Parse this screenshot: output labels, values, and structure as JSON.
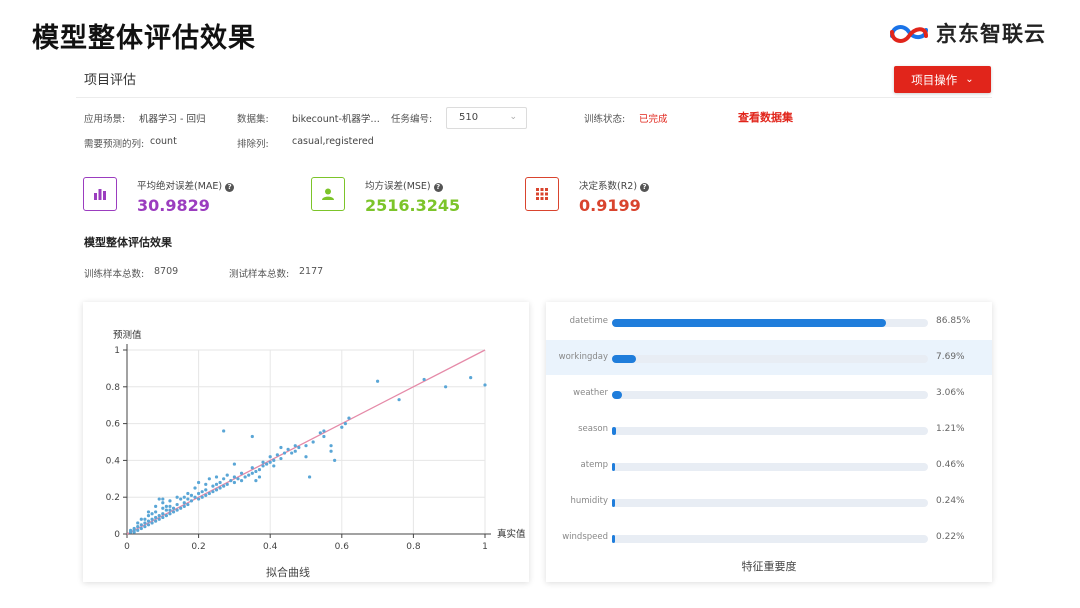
{
  "slide_title": "模型整体评估效果",
  "brand": {
    "name": "京东智联云"
  },
  "panel": {
    "title": "项目评估",
    "op_button": "项目操作",
    "view_data": "查看数据集"
  },
  "info": {
    "scene_label": "应用场景:",
    "scene_value": "机器学习 - 回归",
    "dataset_label": "数据集:",
    "dataset_value": "bikecount-机器学…",
    "task_label": "任务编号:",
    "task_value": "510",
    "status_label": "训练状态:",
    "status_value": "已完成",
    "predict_col_label": "需要预测的列:",
    "predict_col_value": "count",
    "exclude_label": "排除列:",
    "exclude_value": "casual,registered"
  },
  "metrics": [
    {
      "label": "平均绝对误差(MAE)",
      "value": "30.9829",
      "color": "#9b3dbf",
      "icon": "bar-chart-icon"
    },
    {
      "label": "均方误差(MSE)",
      "value": "2516.3245",
      "color": "#7cc42a",
      "icon": "person-icon"
    },
    {
      "label": "决定系数(R2)",
      "value": "0.9199",
      "color": "#d9442e",
      "icon": "grid-icon"
    }
  ],
  "section_title": "模型整体评估效果",
  "samples": {
    "train_label": "训练样本总数:",
    "train_value": "8709",
    "test_label": "测试样本总数:",
    "test_value": "2177"
  },
  "chart_data": [
    {
      "type": "scatter",
      "title": "拟合曲线",
      "xlabel": "真实值",
      "ylabel": "预测值",
      "xlim": [
        0,
        1
      ],
      "ylim": [
        0,
        1
      ],
      "xticks": [
        "0",
        "0.2",
        "0.4",
        "0.6",
        "0.8",
        "1"
      ],
      "yticks": [
        "0",
        "0.2",
        "0.4",
        "0.6",
        "0.8",
        "1"
      ],
      "grid": true,
      "fit_line": {
        "x": [
          0,
          1
        ],
        "y": [
          0,
          1
        ],
        "color": "#e58aa8"
      },
      "point_color": "#5aa6d6",
      "points": [
        [
          0.01,
          0.01
        ],
        [
          0.01,
          0.02
        ],
        [
          0.02,
          0.01
        ],
        [
          0.02,
          0.03
        ],
        [
          0.03,
          0.02
        ],
        [
          0.03,
          0.04
        ],
        [
          0.02,
          0.02
        ],
        [
          0.04,
          0.03
        ],
        [
          0.04,
          0.05
        ],
        [
          0.05,
          0.04
        ],
        [
          0.05,
          0.06
        ],
        [
          0.06,
          0.05
        ],
        [
          0.06,
          0.07
        ],
        [
          0.07,
          0.06
        ],
        [
          0.07,
          0.08
        ],
        [
          0.08,
          0.07
        ],
        [
          0.03,
          0.06
        ],
        [
          0.05,
          0.08
        ],
        [
          0.06,
          0.1
        ],
        [
          0.08,
          0.09
        ],
        [
          0.09,
          0.08
        ],
        [
          0.09,
          0.1
        ],
        [
          0.1,
          0.09
        ],
        [
          0.1,
          0.11
        ],
        [
          0.11,
          0.1
        ],
        [
          0.07,
          0.11
        ],
        [
          0.08,
          0.12
        ],
        [
          0.11,
          0.13
        ],
        [
          0.12,
          0.11
        ],
        [
          0.12,
          0.13
        ],
        [
          0.13,
          0.12
        ],
        [
          0.13,
          0.14
        ],
        [
          0.14,
          0.13
        ],
        [
          0.15,
          0.14
        ],
        [
          0.1,
          0.14
        ],
        [
          0.12,
          0.15
        ],
        [
          0.14,
          0.16
        ],
        [
          0.16,
          0.15
        ],
        [
          0.16,
          0.17
        ],
        [
          0.17,
          0.16
        ],
        [
          0.08,
          0.15
        ],
        [
          0.09,
          0.19
        ],
        [
          0.1,
          0.17
        ],
        [
          0.1,
          0.19
        ],
        [
          0.11,
          0.15
        ],
        [
          0.12,
          0.18
        ],
        [
          0.15,
          0.19
        ],
        [
          0.16,
          0.2
        ],
        [
          0.17,
          0.19
        ],
        [
          0.18,
          0.18
        ],
        [
          0.18,
          0.21
        ],
        [
          0.19,
          0.2
        ],
        [
          0.2,
          0.19
        ],
        [
          0.2,
          0.22
        ],
        [
          0.21,
          0.2
        ],
        [
          0.21,
          0.23
        ],
        [
          0.22,
          0.21
        ],
        [
          0.22,
          0.24
        ],
        [
          0.23,
          0.22
        ],
        [
          0.24,
          0.23
        ],
        [
          0.19,
          0.25
        ],
        [
          0.2,
          0.28
        ],
        [
          0.22,
          0.27
        ],
        [
          0.24,
          0.26
        ],
        [
          0.25,
          0.24
        ],
        [
          0.25,
          0.27
        ],
        [
          0.26,
          0.25
        ],
        [
          0.26,
          0.28
        ],
        [
          0.27,
          0.26
        ],
        [
          0.27,
          0.3
        ],
        [
          0.28,
          0.27
        ],
        [
          0.29,
          0.29
        ],
        [
          0.3,
          0.28
        ],
        [
          0.3,
          0.31
        ],
        [
          0.23,
          0.3
        ],
        [
          0.25,
          0.31
        ],
        [
          0.28,
          0.32
        ],
        [
          0.31,
          0.3
        ],
        [
          0.32,
          0.29
        ],
        [
          0.32,
          0.33
        ],
        [
          0.33,
          0.31
        ],
        [
          0.34,
          0.32
        ],
        [
          0.35,
          0.33
        ],
        [
          0.35,
          0.36
        ],
        [
          0.36,
          0.34
        ],
        [
          0.37,
          0.35
        ],
        [
          0.38,
          0.37
        ],
        [
          0.36,
          0.29
        ],
        [
          0.37,
          0.31
        ],
        [
          0.38,
          0.39
        ],
        [
          0.39,
          0.38
        ],
        [
          0.4,
          0.39
        ],
        [
          0.4,
          0.42
        ],
        [
          0.41,
          0.4
        ],
        [
          0.42,
          0.43
        ],
        [
          0.43,
          0.41
        ],
        [
          0.44,
          0.44
        ],
        [
          0.45,
          0.46
        ],
        [
          0.46,
          0.44
        ],
        [
          0.47,
          0.45
        ],
        [
          0.48,
          0.47
        ],
        [
          0.5,
          0.48
        ],
        [
          0.52,
          0.5
        ],
        [
          0.54,
          0.55
        ],
        [
          0.55,
          0.53
        ],
        [
          0.57,
          0.48
        ],
        [
          0.6,
          0.58
        ],
        [
          0.61,
          0.6
        ],
        [
          0.62,
          0.63
        ],
        [
          0.7,
          0.83
        ],
        [
          0.76,
          0.73
        ],
        [
          0.83,
          0.84
        ],
        [
          0.89,
          0.8
        ],
        [
          0.96,
          0.85
        ],
        [
          1.0,
          0.81
        ],
        [
          0.27,
          0.56
        ],
        [
          0.3,
          0.38
        ],
        [
          0.35,
          0.53
        ],
        [
          0.41,
          0.37
        ],
        [
          0.43,
          0.47
        ],
        [
          0.47,
          0.48
        ],
        [
          0.5,
          0.42
        ],
        [
          0.51,
          0.31
        ],
        [
          0.55,
          0.56
        ],
        [
          0.57,
          0.45
        ],
        [
          0.58,
          0.4
        ],
        [
          0.17,
          0.22
        ],
        [
          0.14,
          0.2
        ],
        [
          0.06,
          0.12
        ],
        [
          0.04,
          0.08
        ]
      ]
    },
    {
      "type": "bar",
      "orientation": "horizontal",
      "title": "特征重要度",
      "categories": [
        "datetime",
        "workingday",
        "weather",
        "season",
        "atemp",
        "humidity",
        "windspeed"
      ],
      "values": [
        86.85,
        7.69,
        3.06,
        1.21,
        0.46,
        0.24,
        0.22
      ],
      "value_labels": [
        "86.85%",
        "7.69%",
        "3.06%",
        "1.21%",
        "0.46%",
        "0.24%",
        "0.22%"
      ],
      "xlim": [
        0,
        100
      ],
      "bar_color": "#1f7ddb",
      "highlighted": "workingday"
    }
  ]
}
